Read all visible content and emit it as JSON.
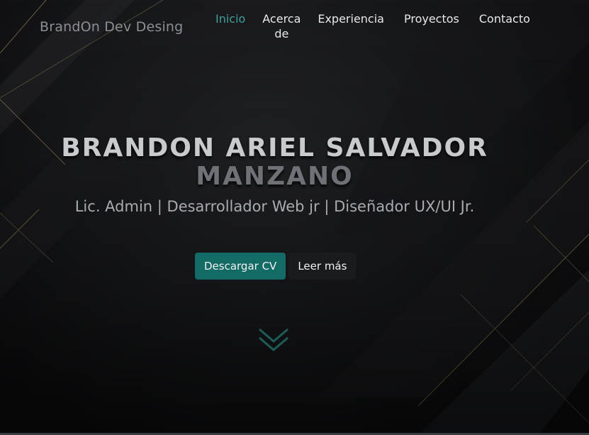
{
  "header": {
    "brand": "BrandOn Dev Desing",
    "nav": [
      {
        "label": "Inicio",
        "active": true
      },
      {
        "label": "Acerca de",
        "active": false
      },
      {
        "label": "Experiencia",
        "active": false
      },
      {
        "label": "Proyectos",
        "active": false
      },
      {
        "label": "Contacto",
        "active": false
      }
    ]
  },
  "hero": {
    "name_line1": "BRANDON ARIEL SALVADOR",
    "name_line2": "MANZANO",
    "subtitle": "Lic. Admin | Desarrollador Web jr | Diseñador UX/UI Jr.",
    "download_cv_label": "Descargar CV",
    "read_more_label": "Leer más"
  },
  "icons": {
    "scroll_down": "double-chevron-down-icon"
  },
  "colors": {
    "accent": "#136b65",
    "nav_active": "#3fa09a",
    "background": "#101113",
    "gold_lines": "#8a7a52"
  }
}
